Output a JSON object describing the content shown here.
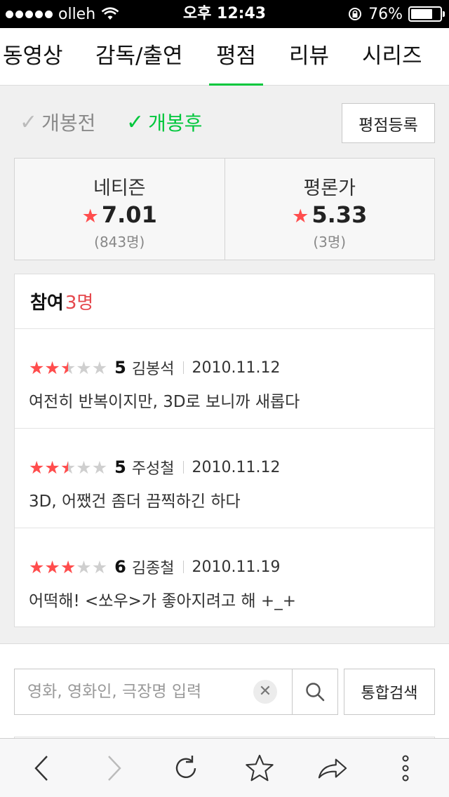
{
  "status_bar": {
    "carrier": "olleh",
    "time": "오후 12:43",
    "battery_percent": "76%",
    "battery_level": 0.76
  },
  "tabs": [
    {
      "label": "동영상",
      "active": false
    },
    {
      "label": "감독/출연",
      "active": false
    },
    {
      "label": "평점",
      "active": true
    },
    {
      "label": "리뷰",
      "active": false
    },
    {
      "label": "시리즈",
      "active": false
    }
  ],
  "filter": {
    "before": "개봉전",
    "after": "개봉후",
    "register_button": "평점등록"
  },
  "scores": {
    "netizen": {
      "label": "네티즌",
      "value": "7.01",
      "count": "(843명)"
    },
    "critic": {
      "label": "평론가",
      "value": "5.33",
      "count": "(3명)"
    }
  },
  "reviews_header": {
    "title": "참여",
    "count": "3명"
  },
  "reviews": [
    {
      "score": "5",
      "stars_filled": 2.5,
      "name": "김봉석",
      "date": "2010.11.12",
      "text": "여전히 반복이지만, 3D로 보니까 새롭다"
    },
    {
      "score": "5",
      "stars_filled": 2.5,
      "name": "주성철",
      "date": "2010.11.12",
      "text": "3D, 어쨌건 좀더 끔찍하긴 하다"
    },
    {
      "score": "6",
      "stars_filled": 3,
      "name": "김종철",
      "date": "2010.11.19",
      "text": "어떡해! <쏘우>가 좋아지려고 해 +_+"
    }
  ],
  "search": {
    "placeholder": "영화, 영화인, 극장명 입력",
    "total_button": "통합검색"
  },
  "toolbar": {
    "icons": [
      "back-icon",
      "forward-icon",
      "reload-icon",
      "bookmark-star-icon",
      "share-icon",
      "more-icon"
    ]
  },
  "colors": {
    "accent_green": "#00c73c",
    "star_red": "#ff4d4d",
    "count_red": "#e5484d"
  }
}
